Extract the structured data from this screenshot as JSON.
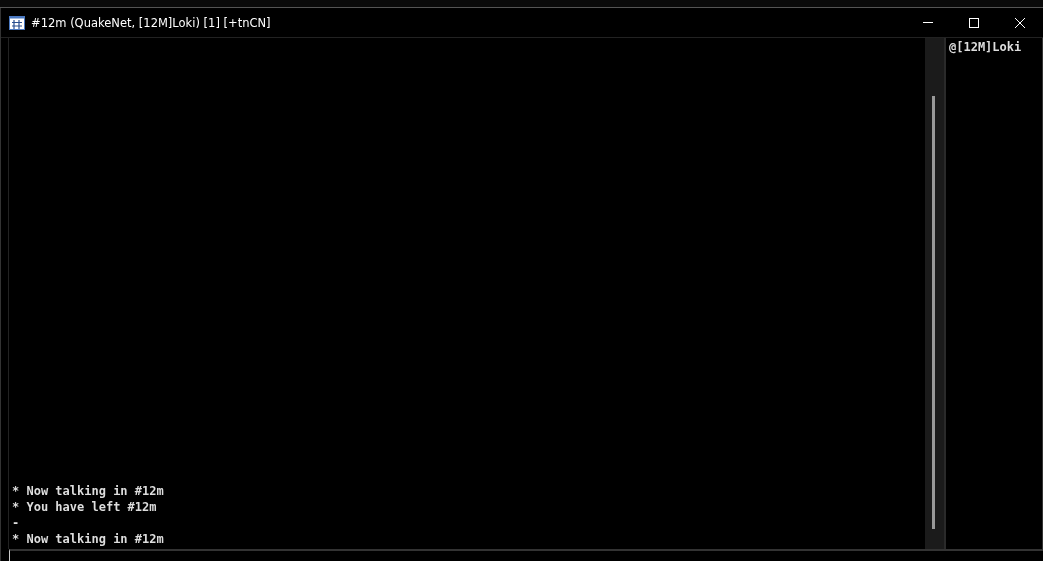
{
  "window": {
    "title": "#12m (QuakeNet, [12M]Loki) [1] [+tnCN]"
  },
  "messages": [
    "* Now talking in #12m",
    "* You have left #12m",
    "-",
    "* Now talking in #12m"
  ],
  "nicklist": [
    "@[12M]Loki"
  ]
}
